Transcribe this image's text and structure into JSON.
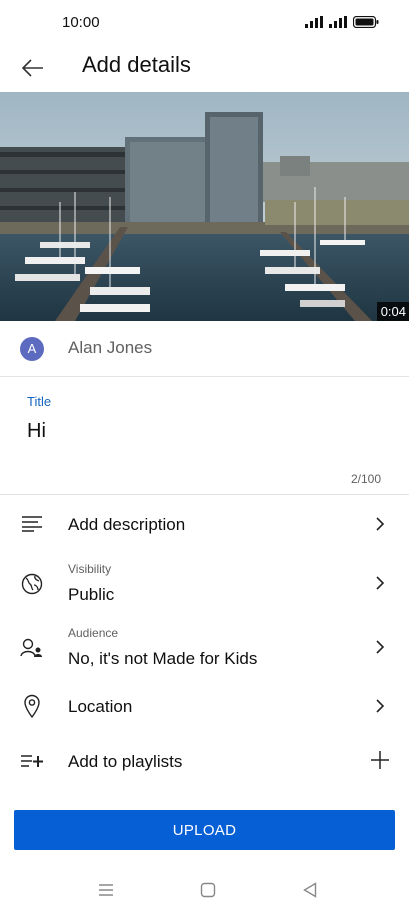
{
  "status_bar": {
    "time": "10:00"
  },
  "header": {
    "title": "Add details"
  },
  "video": {
    "duration": "0:04"
  },
  "channel": {
    "avatar_letter": "A",
    "name": "Alan Jones",
    "avatar_color": "#5c6bc0"
  },
  "title_field": {
    "label": "Title",
    "value": "Hi",
    "counter": "2/100"
  },
  "rows": {
    "description": {
      "label": "Add description",
      "icon": "description-lines-icon"
    },
    "visibility": {
      "caption": "Visibility",
      "value": "Public",
      "icon": "globe-icon"
    },
    "audience": {
      "caption": "Audience",
      "value": "No, it's not Made for Kids",
      "icon": "audience-people-icon"
    },
    "location": {
      "label": "Location",
      "icon": "location-pin-icon"
    },
    "playlists": {
      "label": "Add to playlists",
      "icon": "playlist-add-icon"
    }
  },
  "upload_button": {
    "label": "UPLOAD"
  },
  "colors": {
    "accent": "#065fd4",
    "link_blue": "#1565c0",
    "secondary_text": "#606060"
  }
}
